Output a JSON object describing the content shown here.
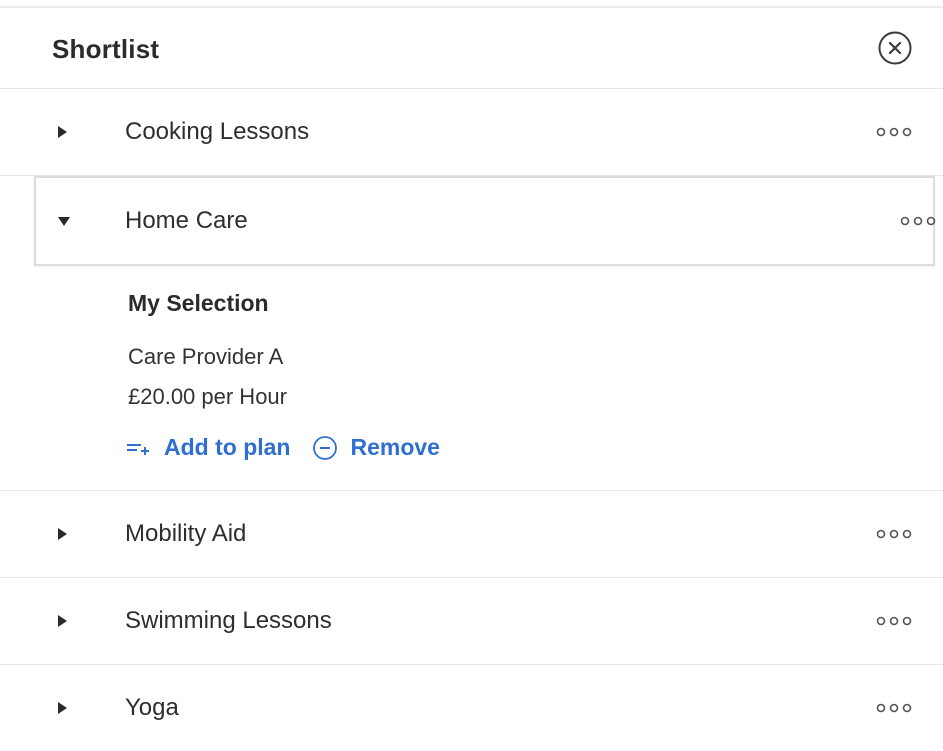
{
  "panel": {
    "title": "Shortlist",
    "close_icon": "close-circle-icon"
  },
  "items": [
    {
      "label": "Cooking Lessons",
      "expanded": false
    },
    {
      "label": "Home Care",
      "expanded": true
    },
    {
      "label": "Mobility Aid",
      "expanded": false
    },
    {
      "label": "Swimming Lessons",
      "expanded": false
    },
    {
      "label": "Yoga",
      "expanded": false
    }
  ],
  "selection": {
    "heading": "My Selection",
    "provider": "Care Provider A",
    "price": "£20.00 per Hour",
    "add_label": "Add to plan",
    "remove_label": "Remove"
  },
  "colors": {
    "accent": "#2f6fd0",
    "text": "#2e2e2e",
    "divider": "#e6e6e6"
  }
}
